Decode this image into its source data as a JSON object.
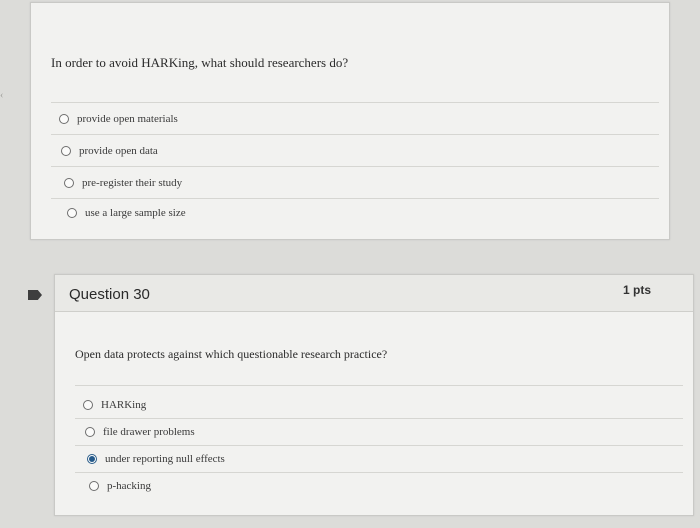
{
  "question_29": {
    "text": "In order to avoid HARKing, what should researchers do?",
    "options": [
      {
        "label": "provide open materials",
        "selected": false
      },
      {
        "label": "provide open data",
        "selected": false
      },
      {
        "label": "pre-register their study",
        "selected": false
      },
      {
        "label": "use a large sample size",
        "selected": false
      }
    ]
  },
  "question_30": {
    "title": "Question 30",
    "points": "1 pts",
    "text": "Open data protects against which questionable research practice?",
    "options": [
      {
        "label": "HARKing",
        "selected": false
      },
      {
        "label": "file drawer problems",
        "selected": false
      },
      {
        "label": "under reporting null effects",
        "selected": true
      },
      {
        "label": "p-hacking",
        "selected": false
      }
    ]
  },
  "icons": {
    "flag": "flag-icon",
    "side": "chevron-left-icon"
  },
  "colors": {
    "selected_radio": "#24598a",
    "flag": "#3e3e3e"
  }
}
